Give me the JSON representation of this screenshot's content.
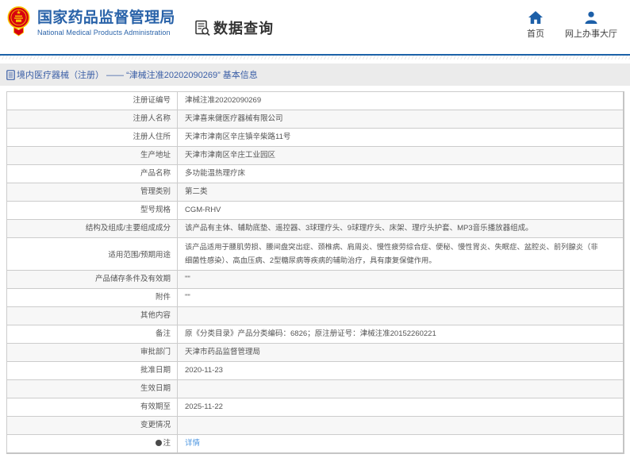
{
  "header": {
    "title": "国家药品监督管理局",
    "subtitle": "National Medical Products Administration",
    "search_label": "数据查询",
    "nav": [
      {
        "label": "首页",
        "icon": "home-icon"
      },
      {
        "label": "网上办事大厅",
        "icon": "user-icon"
      }
    ]
  },
  "breadcrumb": {
    "text": "境内医疗器械（注册） ——  “津械注准20202090269”  基本信息"
  },
  "colors": {
    "brand_blue": "#2a63a9",
    "line_blue": "#1c62a8",
    "crumb_bg": "#ebebeb",
    "stripe_bg": "#f7f7f7",
    "link_blue": "#4c96e0"
  },
  "table": {
    "rows": [
      {
        "label": "注册证编号",
        "value": "津械注准20202090269"
      },
      {
        "label": "注册人名称",
        "value": "天津喜来健医疗器械有限公司"
      },
      {
        "label": "注册人住所",
        "value": "天津市津南区辛庄镇辛柴路11号"
      },
      {
        "label": "生产地址",
        "value": "天津市津南区辛庄工业园区"
      },
      {
        "label": "产品名称",
        "value": "多功能温热理疗床"
      },
      {
        "label": "管理类别",
        "value": "第二类"
      },
      {
        "label": "型号规格",
        "value": "CGM-RHV"
      },
      {
        "label": "结构及组成/主要组成成分",
        "value": "该产品有主体、辅助底垫、遥控器、3球理疗头、9球理疗头、床架、理疗头护套、MP3音乐播放器组成。"
      },
      {
        "label": "适用范围/预期用途",
        "value": "该产品适用于腰肌劳损、腰间盘突出症、颈椎病、肩周炎、慢性疲劳综合症、便秘、慢性胃炎、失眠症、盆腔炎、前列腺炎（非细菌性感染）、高血压病、2型糖尿病等疾病的辅助治疗，具有康复保健作用。",
        "multi": true
      },
      {
        "label": "产品储存条件及有效期",
        "value": "\"\""
      },
      {
        "label": "附件",
        "value": "\"\""
      },
      {
        "label": "其他内容",
        "value": ""
      },
      {
        "label": "备注",
        "value": "原《分类目录》产品分类编码：6826；原注册证号：津械注准20152260221"
      },
      {
        "label": "审批部门",
        "value": "天津市药品监督管理局"
      },
      {
        "label": "批准日期",
        "value": "2020-11-23"
      },
      {
        "label": "生效日期",
        "value": ""
      },
      {
        "label": "有效期至",
        "value": "2025-11-22"
      },
      {
        "label": "变更情况",
        "value": ""
      },
      {
        "label": "注",
        "value": "详情",
        "link": true,
        "dot": true
      }
    ]
  }
}
